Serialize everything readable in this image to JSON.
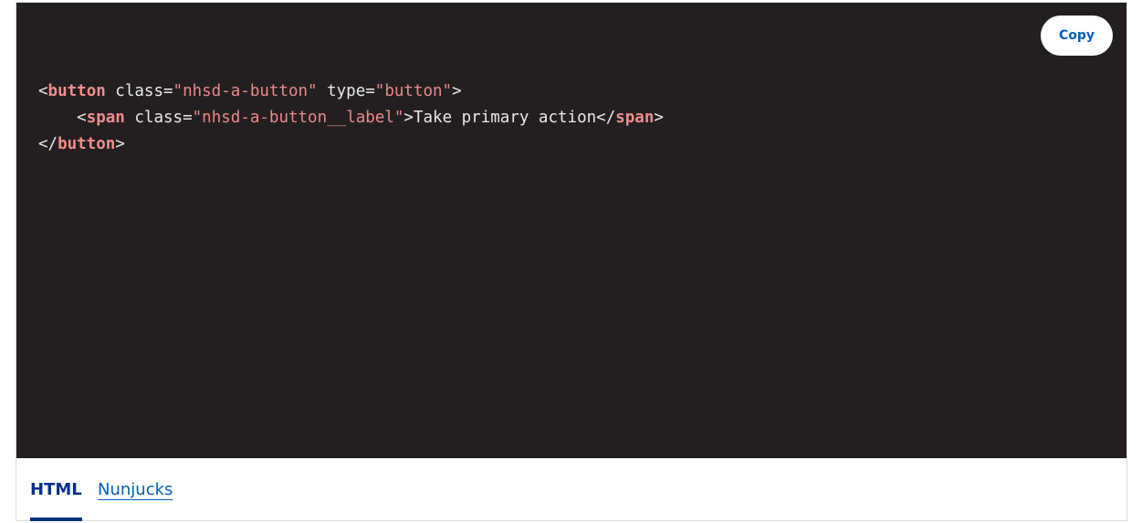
{
  "copy_button": {
    "label": "Copy"
  },
  "code": {
    "line1": {
      "open": "<",
      "tag": "button",
      "attr1": " class=",
      "val1": "\"nhsd-a-button\"",
      "attr2": " type=",
      "val2": "\"button\"",
      "close": ">"
    },
    "line2": {
      "indent": "    ",
      "open": "<",
      "tag": "span",
      "attr1": " class=",
      "val1": "\"nhsd-a-button__label\"",
      "gt": ">",
      "text": "Take primary action",
      "close_open": "</",
      "close_tag": "span",
      "close": ">"
    },
    "line3": {
      "open": "</",
      "tag": "button",
      "close": ">"
    }
  },
  "tabs": [
    {
      "label": "HTML",
      "active": true
    },
    {
      "label": "Nunjucks",
      "active": false
    }
  ],
  "colors": {
    "code_background": "#231f20",
    "tag": "#f08d8d",
    "string": "#e9898a",
    "active_tab": "#003087",
    "link": "#005eb8"
  }
}
